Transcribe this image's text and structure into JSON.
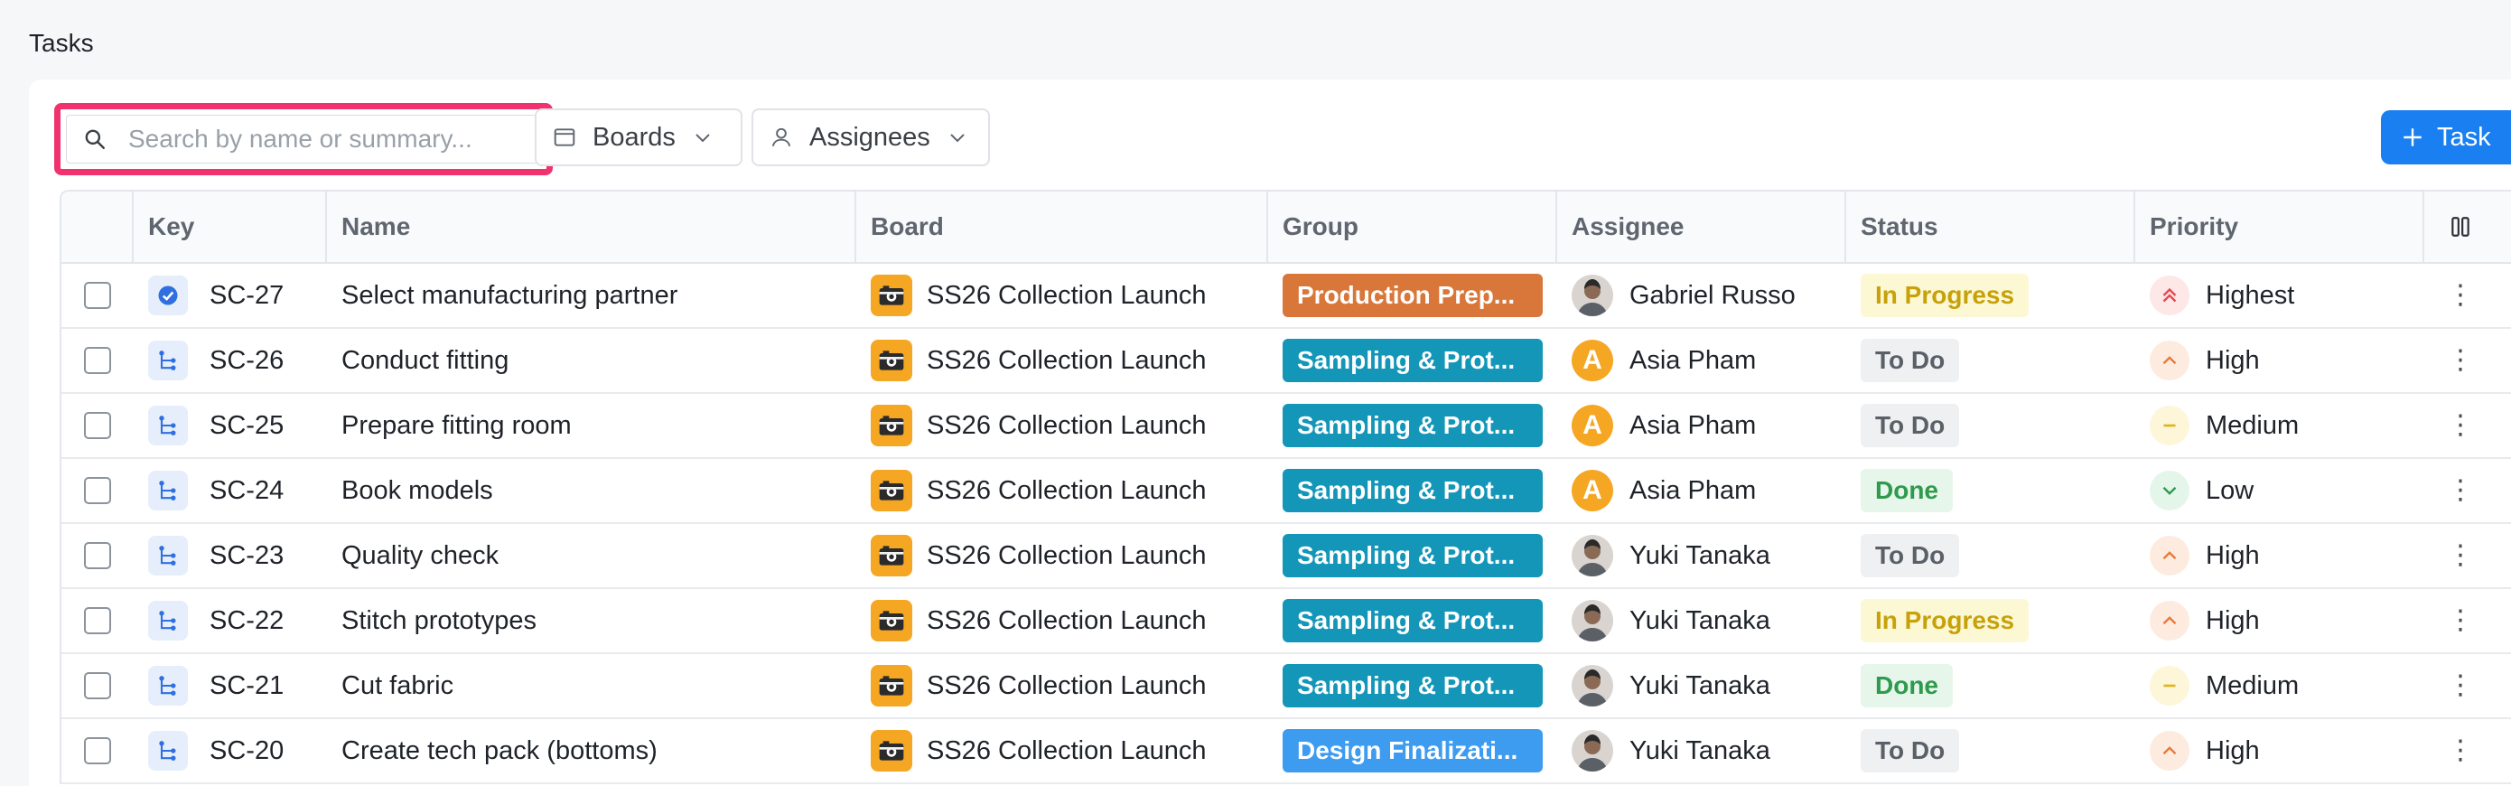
{
  "page": {
    "title": "Tasks"
  },
  "toolbar": {
    "search_placeholder": "Search by name or summary...",
    "boards_label": "Boards",
    "assignees_label": "Assignees",
    "add_task_label": "Task"
  },
  "table": {
    "columns": [
      "Key",
      "Name",
      "Board",
      "Group",
      "Assignee",
      "Status",
      "Priority"
    ],
    "rows": [
      {
        "key": "SC-27",
        "type": "checkbox-task",
        "name": "Select manufacturing partner",
        "board": "SS26 Collection Launch",
        "group": "Production Prep...",
        "group_color": "#d9773a",
        "assignee": "Gabriel Russo",
        "avatar": "photo",
        "status": "In Progress",
        "status_kind": "inprogress",
        "priority": "Highest",
        "priority_kind": "highest"
      },
      {
        "key": "SC-26",
        "type": "subtask",
        "name": "Conduct fitting",
        "board": "SS26 Collection Launch",
        "group": "Sampling & Prot...",
        "group_color": "#1396b8",
        "assignee": "Asia Pham",
        "avatar": "A",
        "status": "To Do",
        "status_kind": "todo",
        "priority": "High",
        "priority_kind": "high"
      },
      {
        "key": "SC-25",
        "type": "subtask",
        "name": "Prepare fitting room",
        "board": "SS26 Collection Launch",
        "group": "Sampling & Prot...",
        "group_color": "#1396b8",
        "assignee": "Asia Pham",
        "avatar": "A",
        "status": "To Do",
        "status_kind": "todo",
        "priority": "Medium",
        "priority_kind": "medium"
      },
      {
        "key": "SC-24",
        "type": "subtask",
        "name": "Book models",
        "board": "SS26 Collection Launch",
        "group": "Sampling & Prot...",
        "group_color": "#1396b8",
        "assignee": "Asia Pham",
        "avatar": "A",
        "status": "Done",
        "status_kind": "done",
        "priority": "Low",
        "priority_kind": "low"
      },
      {
        "key": "SC-23",
        "type": "subtask",
        "name": "Quality check",
        "board": "SS26 Collection Launch",
        "group": "Sampling & Prot...",
        "group_color": "#1396b8",
        "assignee": "Yuki Tanaka",
        "avatar": "photo",
        "status": "To Do",
        "status_kind": "todo",
        "priority": "High",
        "priority_kind": "high"
      },
      {
        "key": "SC-22",
        "type": "subtask",
        "name": "Stitch prototypes",
        "board": "SS26 Collection Launch",
        "group": "Sampling & Prot...",
        "group_color": "#1396b8",
        "assignee": "Yuki Tanaka",
        "avatar": "photo",
        "status": "In Progress",
        "status_kind": "inprogress",
        "priority": "High",
        "priority_kind": "high"
      },
      {
        "key": "SC-21",
        "type": "subtask",
        "name": "Cut fabric",
        "board": "SS26 Collection Launch",
        "group": "Sampling & Prot...",
        "group_color": "#1396b8",
        "assignee": "Yuki Tanaka",
        "avatar": "photo",
        "status": "Done",
        "status_kind": "done",
        "priority": "Medium",
        "priority_kind": "medium"
      },
      {
        "key": "SC-20",
        "type": "subtask",
        "name": "Create tech pack (bottoms)",
        "board": "SS26 Collection Launch",
        "group": "Design Finalizati...",
        "group_color": "#3d9bf0",
        "assignee": "Yuki Tanaka",
        "avatar": "photo",
        "status": "To Do",
        "status_kind": "todo",
        "priority": "High",
        "priority_kind": "high"
      }
    ]
  },
  "icons": {
    "search": "search-icon",
    "board": "board-icon",
    "user": "user-icon",
    "chevron": "chevron-down-icon",
    "plus": "plus-icon",
    "columns": "columns-icon",
    "kebab": "kebab-menu-icon"
  }
}
